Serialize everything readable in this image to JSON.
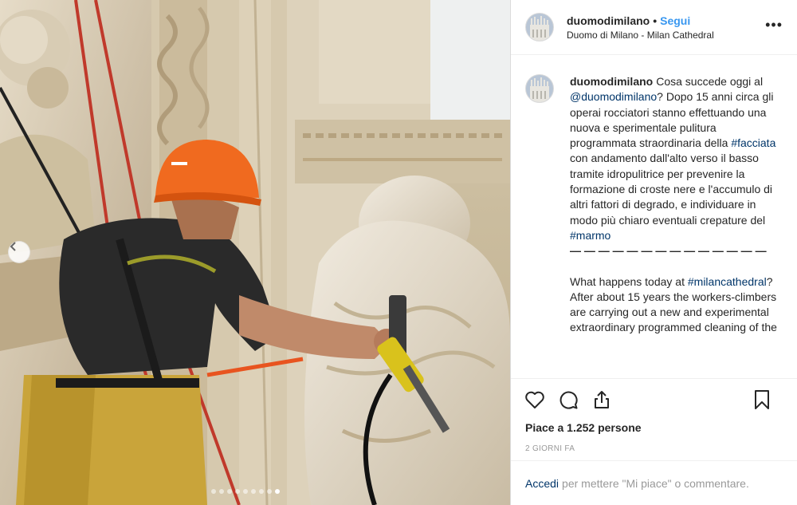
{
  "post": {
    "username": "duomodimilano",
    "separator": "•",
    "follow_label": "Segui",
    "location": "Duomo di Milano - Milan Cathedral",
    "more_label": "•••"
  },
  "caption": {
    "username": "duomodimilano",
    "t1": "Cosa succede oggi al ",
    "mention": "@duomodimilano",
    "t2": "? Dopo 15 anni circa gli operai rocciatori stanno effettuando una nuova e sperimentale pulitura programmata straordinaria della ",
    "tag1": "#facciata",
    "t3": " con andamento dall'alto verso il basso tramite idropulitrice per prevenire la formazione di croste nere e l'accumulo di altri fattori di degrado, e individuare in modo più chiaro eventuali crepature del ",
    "tag2": "#marmo",
    "dashes": "— — — — — — — — — — — — — —",
    "e1": "What happens today at ",
    "tag3": "#milancathedral",
    "e2": "? After about 15 years the workers-climbers are carrying out a new and experimental extraordinary programmed cleaning of the"
  },
  "actions": {
    "likes": "Piace a 1.252 persone",
    "time": "2 GIORNI FA",
    "icons": [
      "heart-icon",
      "comment-icon",
      "share-icon",
      "bookmark-icon"
    ]
  },
  "login": {
    "link": "Accedi",
    "text": "per mettere \"Mi piace\" o commentare."
  },
  "carousel": {
    "slide_count": 9,
    "active_index": 8
  },
  "colors": {
    "follow": "#3897f0",
    "link": "#003569",
    "muted": "#999999",
    "helmet": "#f06a1f"
  }
}
